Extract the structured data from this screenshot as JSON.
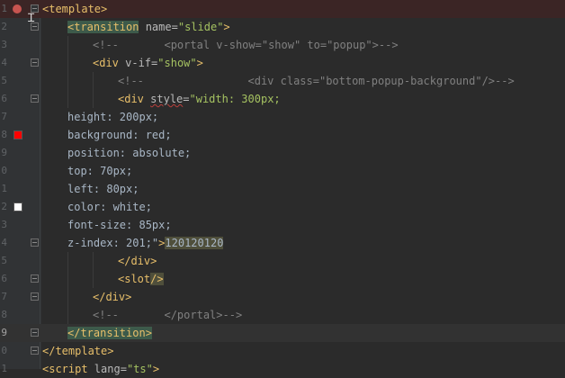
{
  "editor": {
    "lines": [
      {
        "n": "1",
        "tokens": [
          {
            "c": "t",
            "s": "<template>"
          }
        ]
      },
      {
        "n": "2",
        "tokens": [
          {
            "c": "tm",
            "s": "<transition"
          },
          {
            "c": "an",
            "s": " name="
          },
          {
            "c": "av",
            "s": "\"slide\""
          },
          {
            "c": "t",
            "s": ">"
          }
        ]
      },
      {
        "n": "3",
        "tokens": [
          {
            "c": "cm",
            "s": "<!--       <portal v-show=\"show\" to=\"popup\">-->"
          }
        ]
      },
      {
        "n": "4",
        "tokens": [
          {
            "c": "t",
            "s": "<div"
          },
          {
            "c": "an",
            "s": " v-if="
          },
          {
            "c": "av",
            "s": "\"show\""
          },
          {
            "c": "t",
            "s": ">"
          }
        ]
      },
      {
        "n": "5",
        "tokens": [
          {
            "c": "cm",
            "s": "<!--                <div class=\"bottom-popup-background\"/>-->"
          }
        ]
      },
      {
        "n": "6",
        "tokens": [
          {
            "c": "t",
            "s": "<div"
          },
          {
            "c": "an",
            "s": " "
          },
          {
            "c": "an u",
            "s": "style"
          },
          {
            "c": "an",
            "s": "="
          },
          {
            "c": "av",
            "s": "\"width: 300px;"
          }
        ]
      },
      {
        "n": "7",
        "tokens": [
          {
            "c": "pl",
            "s": "height: 200px;"
          }
        ]
      },
      {
        "n": "8",
        "tokens": [
          {
            "c": "pl",
            "s": "background: red;"
          }
        ]
      },
      {
        "n": "9",
        "tokens": [
          {
            "c": "pl",
            "s": "position: absolute;"
          }
        ]
      },
      {
        "n": "0",
        "tokens": [
          {
            "c": "pl",
            "s": "top: 70px;"
          }
        ]
      },
      {
        "n": "1",
        "tokens": [
          {
            "c": "pl",
            "s": "left: 80px;"
          }
        ]
      },
      {
        "n": "2",
        "tokens": [
          {
            "c": "pl",
            "s": "color: white;"
          }
        ]
      },
      {
        "n": "3",
        "tokens": [
          {
            "c": "pl",
            "s": "font-size: 85px;"
          }
        ]
      },
      {
        "n": "4",
        "tokens": [
          {
            "c": "pl",
            "s": "z-index: 201;\""
          },
          {
            "c": "t",
            "s": ">"
          },
          {
            "c": "pl bd",
            "s": "120120120"
          }
        ]
      },
      {
        "n": "5",
        "tokens": [
          {
            "c": "t",
            "s": "</div>"
          }
        ]
      },
      {
        "n": "6",
        "tokens": [
          {
            "c": "t",
            "s": "<slot"
          },
          {
            "c": "t bd",
            "s": "/>"
          }
        ]
      },
      {
        "n": "7",
        "tokens": [
          {
            "c": "t",
            "s": "</div>"
          }
        ]
      },
      {
        "n": "8",
        "tokens": [
          {
            "c": "cm",
            "s": "<!--       </portal>-->"
          }
        ]
      },
      {
        "n": "9",
        "tokens": [
          {
            "c": "tm",
            "s": "</transition>"
          }
        ]
      },
      {
        "n": "0",
        "tokens": [
          {
            "c": "t",
            "s": "</template>"
          }
        ]
      },
      {
        "n": "1",
        "tokens": [
          {
            "c": "t",
            "s": "<script"
          },
          {
            "c": "an",
            "s": " lang="
          },
          {
            "c": "av",
            "s": "\"ts\""
          },
          {
            "c": "t",
            "s": ">"
          }
        ]
      }
    ]
  },
  "gutter_colors": {
    "breakpoint": "#c75450",
    "swatch_red": "#ff0000",
    "swatch_white": "#ffffff"
  },
  "icons": {
    "breakpoint": "breakpoint-icon",
    "fold": "fold-marker-icon",
    "cursor": "text-cursor-icon"
  }
}
